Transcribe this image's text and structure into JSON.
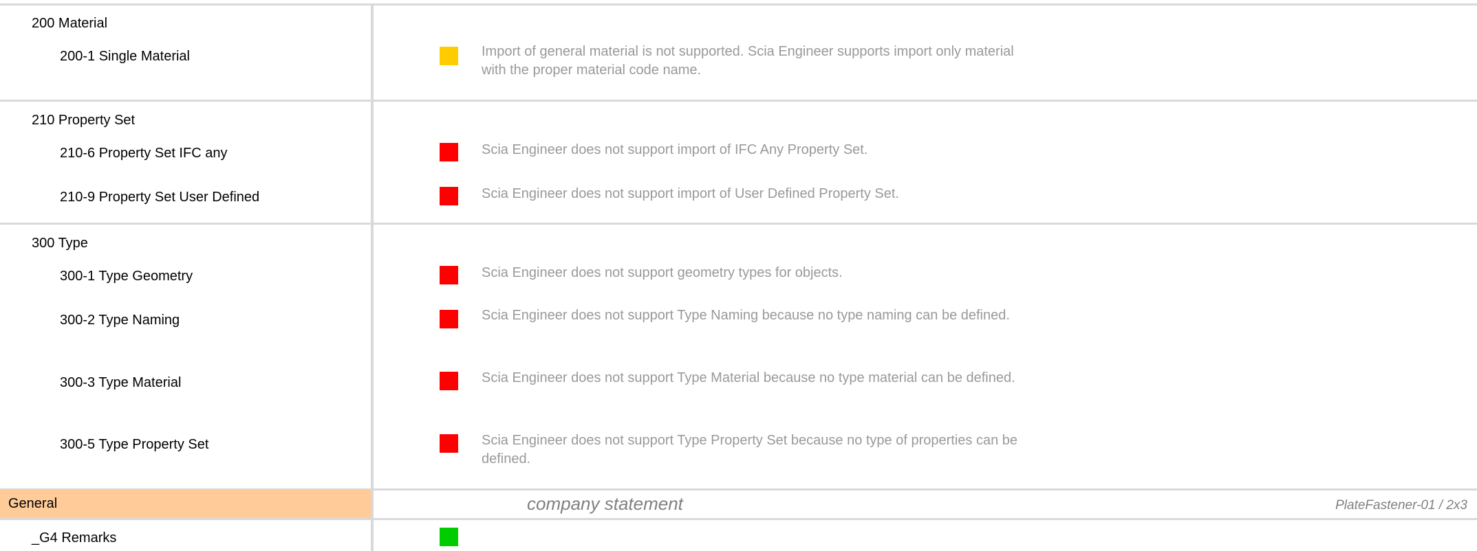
{
  "sections": [
    {
      "title": "200 Material",
      "items": [
        {
          "label": "200-1 Single Material",
          "status": "yellow",
          "description": "Import of general material is not supported. Scia Engineer supports import only material with the proper material code name."
        }
      ]
    },
    {
      "title": "210 Property Set",
      "items": [
        {
          "label": "210-6 Property Set IFC any",
          "status": "red",
          "description": "Scia Engineer does not support import of IFC Any Property Set."
        },
        {
          "label": "210-9 Property Set User Defined",
          "status": "red",
          "description": "Scia Engineer does not support import of User Defined Property Set."
        }
      ]
    },
    {
      "title": "300 Type",
      "items": [
        {
          "label": "300-1 Type Geometry",
          "status": "red",
          "description": "Scia Engineer does not support geometry types for objects."
        },
        {
          "label": "300-2 Type Naming",
          "status": "red",
          "description": "Scia Engineer does not support Type Naming because no type naming can be defined."
        },
        {
          "label": "300-3 Type Material",
          "status": "red",
          "description": "Scia Engineer does not support Type Material because no type material can be defined."
        },
        {
          "label": "300-5 Type Property Set",
          "status": "red",
          "description": "Scia Engineer does not support Type Property Set because no type of properties can be defined."
        }
      ]
    }
  ],
  "footer": {
    "general_label": "General",
    "company_statement": "company statement",
    "page_ref": "PlateFastener-01 / 2x3"
  },
  "remarks": {
    "label": "_G4 Remarks",
    "status": "green"
  },
  "colors": {
    "yellow": "#ffcc00",
    "red": "#ff0000",
    "green": "#00cc00",
    "general_highlight": "#ffcc99",
    "description_text": "#999999",
    "grid_line": "#d9d9d9"
  }
}
